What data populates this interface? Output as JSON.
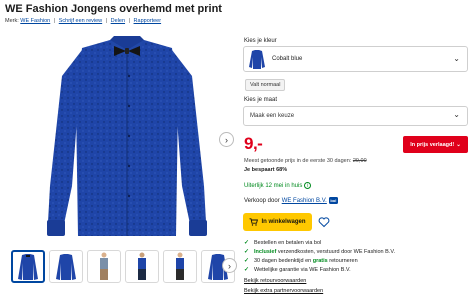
{
  "product": {
    "title": "WE Fashion Jongens overhemd met print"
  },
  "meta": {
    "brand_prefix": "Merk:",
    "brand": "WE Fashion",
    "review_link": "Schrijf een review",
    "share_link": "Delen",
    "report_link": "Rapporteer",
    "separator": "|"
  },
  "variant": {
    "color_label": "Kies je kleur",
    "color_value": "Cobalt blue",
    "fit_badge": "Valt normaal",
    "size_label": "Kies je maat",
    "size_placeholder": "Maak een keuze"
  },
  "pricing": {
    "price": "9,-",
    "price_drop_button": "In prijs verlaagd!",
    "prev_price_text": "Meest getoonde prijs in de eerste 30 dagen:",
    "prev_price": "29,00",
    "savings": "Je bespaart 68%"
  },
  "delivery": {
    "text": "Uiterlijk 12 mei in huis",
    "info_icon": "i"
  },
  "seller": {
    "prefix": "Verkoop door",
    "name": "WE Fashion B.V.",
    "badge": "bol"
  },
  "actions": {
    "cart_button": "In winkelwagen"
  },
  "usps": [
    {
      "pre": "Bestellen en betalen via bol",
      "hl": "",
      "post": ""
    },
    {
      "pre": "",
      "hl": "Inclusief",
      "post": " verzendkosten, verstuurd door WE Fashion B.V."
    },
    {
      "pre": "30 dagen bedenktijd en ",
      "hl": "gratis",
      "post": " retourneren"
    },
    {
      "pre": "Wettelijke garantie via WE Fashion B.V.",
      "hl": "",
      "post": ""
    }
  ],
  "links": {
    "returns": "Bekijk retourvoorwaarden",
    "partner_terms": "Bekijk extra partnervoorwaarden"
  },
  "icons": {
    "next": "chevron-right-icon",
    "select": "chevron-down-icon",
    "cart": "cart-icon",
    "wishlist": "heart-icon",
    "check": "check-icon"
  },
  "colors": {
    "brand_blue": "#0047a0",
    "price_red": "#e0001b",
    "success_green": "#008a1e",
    "cart_yellow": "#ffc800",
    "shirt_blue": "#1f45a8"
  }
}
